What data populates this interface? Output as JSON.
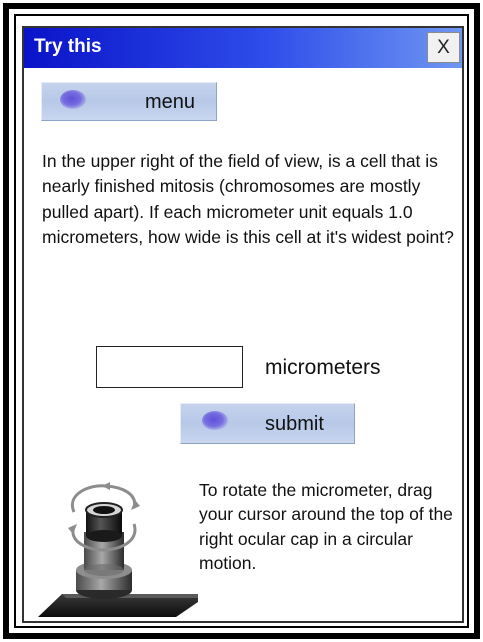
{
  "dialog": {
    "title": "Try this",
    "close_label": "X"
  },
  "menu_button": {
    "label": "menu",
    "icon": "blob-icon"
  },
  "question": {
    "text": "In the upper right of the field of view, is a cell that is nearly finished mitosis (chromosomes are mostly pulled apart). If each micrometer unit equals 1.0 micrometers, how wide is this cell at it's widest point?"
  },
  "answer": {
    "value": "",
    "unit": "micrometers"
  },
  "submit_button": {
    "label": "submit",
    "icon": "blob-icon"
  },
  "hint": {
    "text": "To rotate the micrometer, drag your cursor around the top of the right ocular cap in a circular motion.",
    "icon": "ocular-rotate-icon"
  },
  "colors": {
    "title_bar_start": "#0a13c8",
    "title_bar_end": "#6f96f2",
    "button_face": "#b7c8e8",
    "blob": "#5e52d8"
  }
}
